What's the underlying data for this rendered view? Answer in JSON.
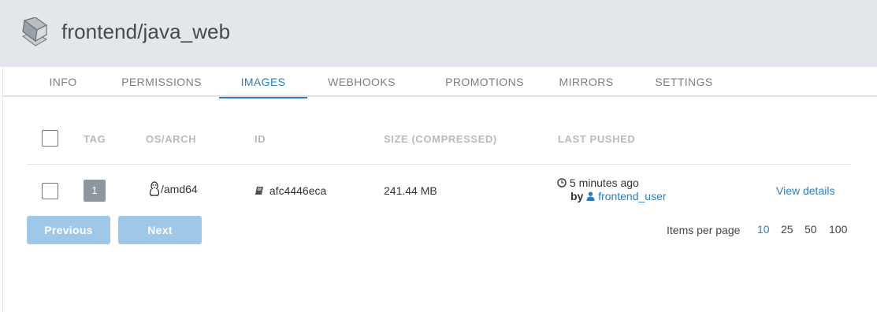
{
  "repo": {
    "title": "frontend/java_web",
    "icon": "repository-icon"
  },
  "tabs": [
    "Info",
    "Permissions",
    "Images",
    "Webhooks",
    "Promotions",
    "Mirrors",
    "Settings"
  ],
  "active_tab": "Images",
  "table": {
    "headers": {
      "tag": "Tag",
      "os_arch": "OS/Arch",
      "id": "ID",
      "size": "Size (compressed)",
      "last_pushed": "Last pushed"
    },
    "rows": [
      {
        "tag": "1",
        "os_arch": "/amd64",
        "os_icon": "linux-penguin-icon",
        "id": "afc4446eca",
        "id_icon": "book-icon",
        "size": "241.44 MB",
        "pushed_time": "5 minutes ago",
        "pushed_by_prefix": "by",
        "pushed_by": "frontend_user",
        "action": "View details"
      }
    ]
  },
  "pagination": {
    "previous_label": "Previous",
    "next_label": "Next",
    "items_per_page_label": "Items per page",
    "options": [
      "10",
      "25",
      "50",
      "100"
    ],
    "selected": "10"
  },
  "colors": {
    "accent": "#2a7fbd",
    "header_bg": "#e3e6ea",
    "button_disabled": "#9fc8e8",
    "badge": "#8e979e"
  }
}
